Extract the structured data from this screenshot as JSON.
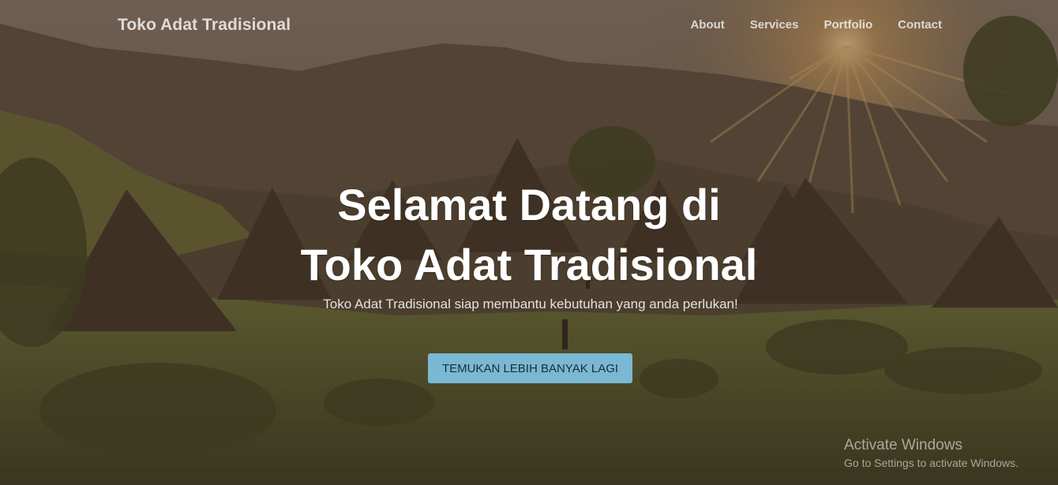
{
  "navbar": {
    "brand": "Toko Adat Tradisional",
    "links": [
      "About",
      "Services",
      "Portfolio",
      "Contact"
    ]
  },
  "hero": {
    "headline_line1": "Selamat Datang di",
    "headline_line2": "Toko Adat Tradisional",
    "subtitle": "Toko Adat Tradisional siap membantu kebutuhan yang anda perlukan!",
    "cta_label": "TEMUKAN LEBIH BANYAK LAGI"
  },
  "watermark": {
    "title": "Activate Windows",
    "subtitle": "Go to Settings to activate Windows."
  },
  "colors": {
    "cta_background": "#7ab8d4",
    "overlay": "#3c2d23"
  }
}
